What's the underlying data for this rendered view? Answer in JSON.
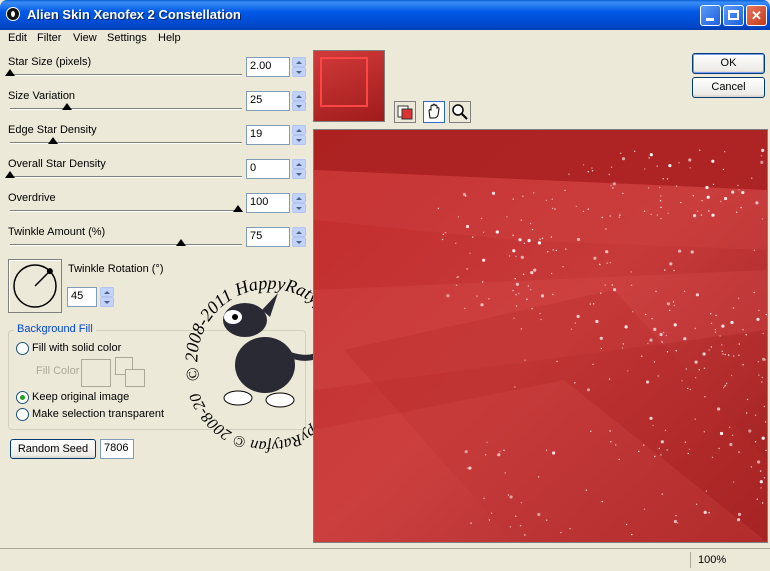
{
  "window": {
    "title": "Alien Skin Xenofex 2 Constellation",
    "icon": "alien-skin-icon",
    "controls": [
      "minimize-icon",
      "maximize-icon",
      "close-icon"
    ]
  },
  "menu": [
    {
      "label": "Edit"
    },
    {
      "label": "Filter"
    },
    {
      "label": "View"
    },
    {
      "label": "Settings"
    },
    {
      "label": "Help"
    }
  ],
  "sliders": [
    {
      "label": "Star Size (pixels)",
      "value": "2.00",
      "level": 0.0
    },
    {
      "label": "Size Variation",
      "value": "25",
      "level": 0.25
    },
    {
      "label": "Edge Star Density",
      "value": "19",
      "level": 0.19
    },
    {
      "label": "Overall Star Density",
      "value": "0",
      "level": 0.0
    },
    {
      "label": "Overdrive",
      "value": "100",
      "level": 1.0
    },
    {
      "label": "Twinkle Amount (%)",
      "value": "75",
      "level": 0.75
    }
  ],
  "twinkle_rotation": {
    "label": "Twinkle Rotation (°)",
    "value": "45",
    "angle": 45
  },
  "background_fill": {
    "title": "Background Fill",
    "options": [
      {
        "label": "Fill with solid color",
        "selected": false
      },
      {
        "label": "Keep original image",
        "selected": true
      },
      {
        "label": "Make selection transparent",
        "selected": false
      }
    ],
    "fill_color_label": "Fill Color"
  },
  "random_seed": {
    "button_label": "Random Seed",
    "value": "7806"
  },
  "dialog_buttons": {
    "ok": "OK",
    "cancel": "Cancel"
  },
  "preview_tools": [
    "preview-compare-icon",
    "hand-icon",
    "magnifier-icon"
  ],
  "watermark": {
    "text": "HappyRatyfan © 2008-2011"
  },
  "status": {
    "zoom": "100%"
  },
  "colors": {
    "preview_red": "#c23333",
    "title_blue": "#0058e6"
  }
}
